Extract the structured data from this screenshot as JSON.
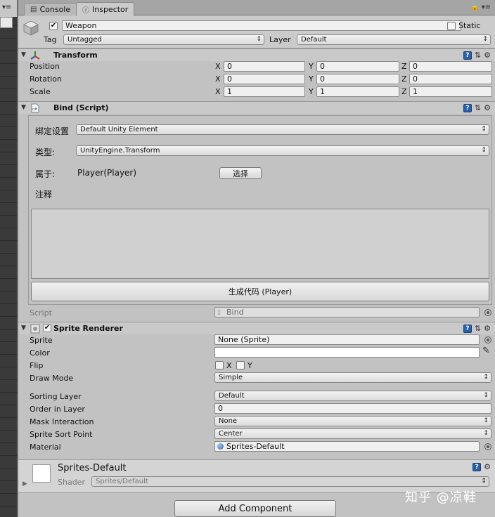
{
  "tabs": {
    "console": "Console",
    "inspector": "Inspector"
  },
  "gameobject": {
    "name": "Weapon",
    "static_label": "Static",
    "tag_label": "Tag",
    "tag_value": "Untagged",
    "layer_label": "Layer",
    "layer_value": "Default"
  },
  "transform": {
    "title": "Transform",
    "rows": [
      {
        "label": "Position",
        "x": "0",
        "y": "0",
        "z": "0"
      },
      {
        "label": "Rotation",
        "x": "0",
        "y": "0",
        "z": "0"
      },
      {
        "label": "Scale",
        "x": "1",
        "y": "1",
        "z": "1"
      }
    ],
    "axis": {
      "x": "X",
      "y": "Y",
      "z": "Z"
    }
  },
  "bind": {
    "title": "Bind (Script)",
    "setting_label": "绑定设置",
    "setting_value": "Default Unity Element",
    "type_label": "类型:",
    "type_value": "UnityEngine.Transform",
    "owner_label": "属于:",
    "owner_value": "Player(Player)",
    "select_button": "选择",
    "comment_label": "注释",
    "generate_button": "生成代码 (Player)",
    "script_label": "Script",
    "script_value": "Bind"
  },
  "sprite_renderer": {
    "title": "Sprite Renderer",
    "sprite_label": "Sprite",
    "sprite_value": "None (Sprite)",
    "color_label": "Color",
    "flip_label": "Flip",
    "flip_x": "X",
    "flip_y": "Y",
    "draw_mode_label": "Draw Mode",
    "draw_mode_value": "Simple",
    "sorting_layer_label": "Sorting Layer",
    "sorting_layer_value": "Default",
    "order_label": "Order in Layer",
    "order_value": "0",
    "mask_label": "Mask Interaction",
    "mask_value": "None",
    "sort_point_label": "Sprite Sort Point",
    "sort_point_value": "Center",
    "material_label": "Material",
    "material_value": "Sprites-Default"
  },
  "material": {
    "name": "Sprites-Default",
    "shader_label": "Shader",
    "shader_value": "Sprites/Default"
  },
  "add_component": "Add Component",
  "watermark": "知乎 @凉鞋"
}
